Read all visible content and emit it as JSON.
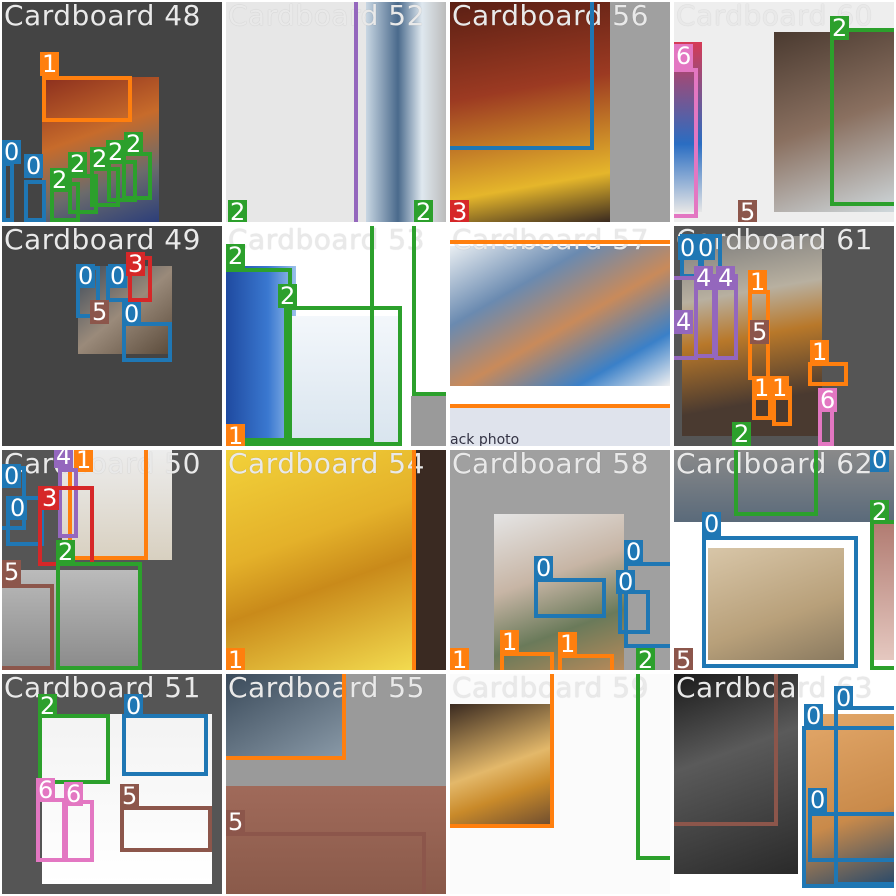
{
  "grid": {
    "tiles": [
      {
        "title": "Cardboard 48"
      },
      {
        "title": "Cardboard 52"
      },
      {
        "title": "Cardboard 56"
      },
      {
        "title": "Cardboard 60"
      },
      {
        "title": "Cardboard 49"
      },
      {
        "title": "Cardboard 53"
      },
      {
        "title": "Cardboard 57"
      },
      {
        "title": "Cardboard 61"
      },
      {
        "title": "Cardboard 50"
      },
      {
        "title": "Cardboard 54"
      },
      {
        "title": "Cardboard 58"
      },
      {
        "title": "Cardboard 62"
      },
      {
        "title": "Cardboard 51"
      },
      {
        "title": "Cardboard 55"
      },
      {
        "title": "Cardboard 59"
      },
      {
        "title": "Cardboard 63"
      }
    ]
  },
  "class_colors": {
    "0": "#1f77b4",
    "1": "#ff7f0e",
    "2": "#2ca02c",
    "3": "#d62728",
    "4": "#9467bd",
    "5": "#8c564b",
    "6": "#e377c2"
  },
  "labels": {
    "l0": "0",
    "l1": "1",
    "l2": "2",
    "l3": "3",
    "l4": "4",
    "l5": "5",
    "l6": "6"
  },
  "footer_text": "ack photo"
}
